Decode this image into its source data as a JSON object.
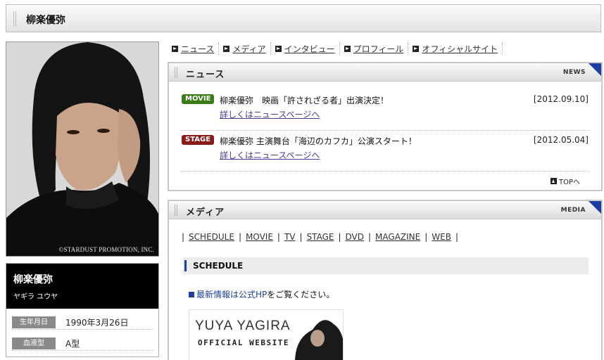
{
  "header": {
    "title": "柳楽優弥"
  },
  "photo": {
    "copyright": "©STARDUST PROMOTION, INC."
  },
  "profile": {
    "name": "柳楽優弥",
    "kana": "ヤギラ ユウヤ",
    "rows": [
      {
        "label": "生年月日",
        "value": "1990年3月26日"
      },
      {
        "label": "血液型",
        "value": "A型"
      }
    ]
  },
  "topnav": [
    "ニュース",
    "メディア",
    "インタビュー",
    "プロフィール",
    "オフィシャルサイト"
  ],
  "news": {
    "title": "ニュース",
    "title_en": "NEWS",
    "items": [
      {
        "badge": "MOVIE",
        "badge_color": "#3a7d17",
        "headline": "柳楽優弥　映画「許されざる者」出演決定！",
        "date": "[2012.09.10]",
        "more": "詳しくはニュースページへ"
      },
      {
        "badge": "STAGE",
        "badge_color": "#8b1a1a",
        "headline": "柳楽優弥 主演舞台「海辺のカフカ」公演スタート！",
        "date": "[2012.05.04]",
        "more": "詳しくはニュースページへ"
      }
    ],
    "to_top": "TOPへ"
  },
  "media": {
    "title": "メディア",
    "title_en": "MEDIA",
    "subnav": [
      "SCHEDULE",
      "MOVIE",
      "TV",
      "STAGE",
      "DVD",
      "MAGAZINE",
      "WEB"
    ],
    "section": "SCHEDULE",
    "notice_pre": "最新情報は公式",
    "notice_link": "HP",
    "notice_post": "をご覧ください。",
    "banner_line1": "YUYA YAGIRA",
    "banner_line2": "OFFICIAL WEBSITE"
  }
}
